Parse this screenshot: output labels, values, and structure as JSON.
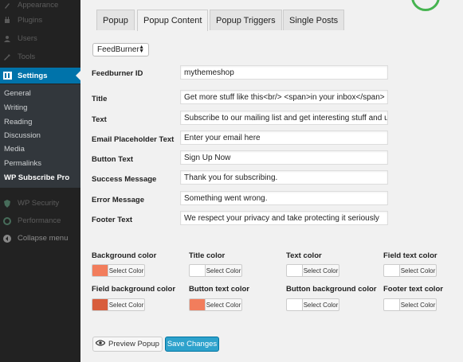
{
  "sidebar": {
    "top_items": [
      {
        "label": "Appearance",
        "icon": "paintbrush-icon"
      },
      {
        "label": "Plugins",
        "icon": "plugin-icon"
      },
      {
        "label": "Users",
        "icon": "users-icon"
      },
      {
        "label": "Tools",
        "icon": "wrench-icon"
      }
    ],
    "active_item": {
      "label": "Settings",
      "icon": "settings-icon"
    },
    "submenu": [
      "General",
      "Writing",
      "Reading",
      "Discussion",
      "Media",
      "Permalinks",
      "WP Subscribe Pro"
    ],
    "bottom_items": [
      {
        "label": "WP Security",
        "icon": "shield-icon"
      },
      {
        "label": "Performance",
        "icon": "gauge-icon"
      },
      {
        "label": "Collapse menu",
        "icon": "collapse-icon"
      }
    ]
  },
  "tabs": [
    "Popup",
    "Popup Content",
    "Popup Triggers",
    "Single Posts"
  ],
  "active_tab": "Popup Content",
  "service_select": {
    "value": "FeedBurner"
  },
  "fields": [
    {
      "label": "Feedburner ID",
      "value": "mythemeshop"
    },
    {
      "label": "Title",
      "value": "Get more stuff like this<br/> <span>in your inbox</span>"
    },
    {
      "label": "Text",
      "value": "Subscribe to our mailing list and get interesting stuff and up"
    },
    {
      "label": "Email Placeholder Text",
      "value": "Enter your email here"
    },
    {
      "label": "Button Text",
      "value": "Sign Up Now"
    },
    {
      "label": "Success Message",
      "value": "Thank you for subscribing."
    },
    {
      "label": "Error Message",
      "value": "Something went wrong."
    },
    {
      "label": "Footer Text",
      "value": "We respect your privacy and take protecting it seriously"
    }
  ],
  "colors": [
    {
      "label": "Background color",
      "swatch": "#f27d5c",
      "button": "Select Color"
    },
    {
      "label": "Title color",
      "swatch": "#ffffff",
      "button": "Select Color"
    },
    {
      "label": "Text color",
      "swatch": "#ffffff",
      "button": "Select Color"
    },
    {
      "label": "Field text color",
      "swatch": "#ffffff",
      "button": "Select Color"
    },
    {
      "label": "Field background color",
      "swatch": "#d85d3c",
      "button": "Select Color"
    },
    {
      "label": "Button text color",
      "swatch": "#f27d5c",
      "button": "Select Color"
    },
    {
      "label": "Button background color",
      "swatch": "#ffffff",
      "button": "Select Color"
    },
    {
      "label": "Footer text color",
      "swatch": "#ffffff",
      "button": "Select Color"
    }
  ],
  "actions": {
    "preview_label": "Preview Popup",
    "save_label": "Save Changes"
  },
  "theme": {
    "sidebar_bg": "#222222",
    "accent": "#0073aa",
    "success": "#46b450",
    "primary_button": "#2ea2cc"
  }
}
